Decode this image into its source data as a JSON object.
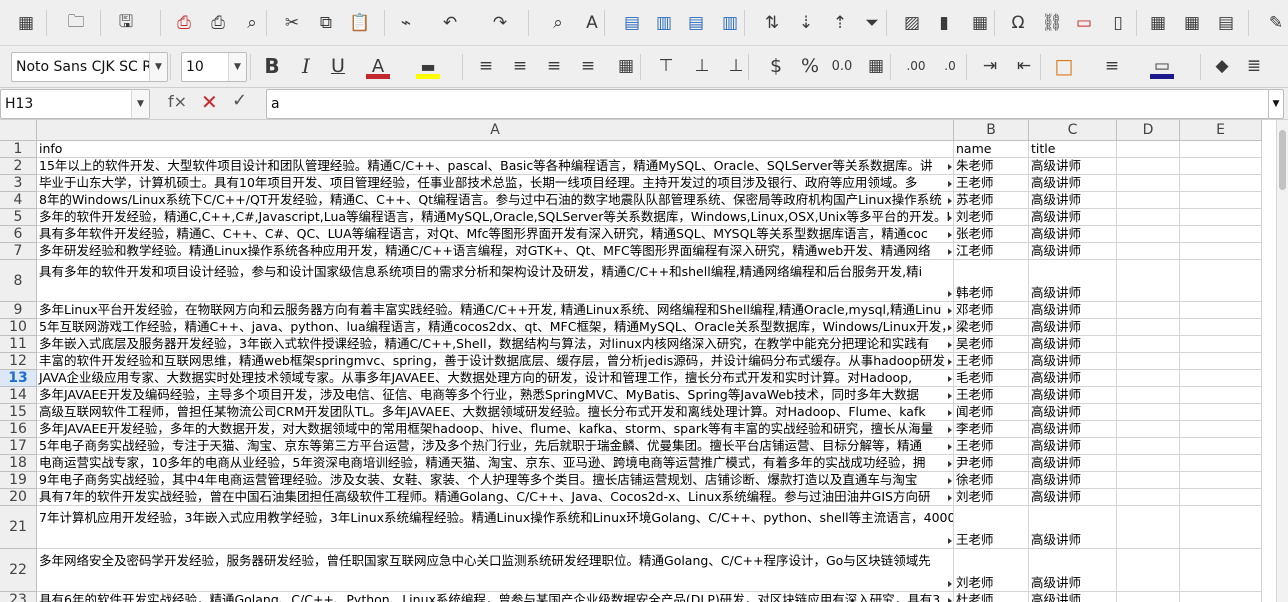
{
  "toolbar": {
    "font_name": "Noto Sans CJK SC R",
    "font_size": "10",
    "font_color": "#c0282e",
    "highlight_color": "#ffff00",
    "border_color": "#1a1a8c",
    "icons": [
      "spreadsheet-icon",
      "open-icon",
      "save-icon",
      "export-pdf-icon",
      "print-icon",
      "print-preview-icon",
      "cut-icon",
      "copy-icon",
      "paste-icon",
      "clone-formatting-icon",
      "undo-icon",
      "redo-icon",
      "find-replace-icon",
      "spelling-icon",
      "row-icon",
      "column-icon",
      "delete-row-icon",
      "delete-column-icon",
      "sort-icon",
      "sort-ascending-icon",
      "sort-descending-icon",
      "autofilter-icon",
      "insert-image-icon",
      "insert-chart-icon",
      "pivot-table-icon",
      "special-character-icon",
      "hyperlink-icon",
      "comment-icon",
      "header-footer-icon",
      "define-print-area-icon",
      "freeze-icon",
      "split-window-icon",
      "show-draw-functions-icon"
    ]
  },
  "formula_bar": {
    "name_box": "H13",
    "function_wizard": "f×",
    "formula": "a"
  },
  "columns": [
    "A",
    "B",
    "C",
    "D",
    "E"
  ],
  "selected_row": "13",
  "rows": [
    {
      "num": "1",
      "a": "info",
      "b": "name",
      "c": "title"
    },
    {
      "num": "2",
      "a": "15年以上的软件开发、大型软件项目设计和团队管理经验。精通C/C++、pascal、Basic等各种编程语言，精通MySQL、Oracle、SQLServer等关系数据库。讲",
      "b": "朱老师",
      "c": "高级讲师"
    },
    {
      "num": "3",
      "a": "毕业于山东大学，计算机硕士。具有10年项目开发、项目管理经验，任事业部技术总监，长期一线项目经理。主持开发过的项目涉及银行、政府等应用领域。多",
      "b": "王老师",
      "c": "高级讲师"
    },
    {
      "num": "4",
      "a": "8年的Windows/Linux系统下C/C++/QT开发经验，精通C、C++、Qt编程语言。参与过中石油的数字地震队队部管理系统、保密局等政府机构国产Linux操作系统",
      "b": "苏老师",
      "c": "高级讲师"
    },
    {
      "num": "5",
      "a": "多年的软件开发经验，精通C,C++,C#,Javascript,Lua等编程语言，精通MySQL,Oracle,SQLServer等关系数据库，Windows,Linux,OSX,Unix等多平台的开发。Ⅰ",
      "b": "刘老师",
      "c": "高级讲师"
    },
    {
      "num": "6",
      "a": "具有多年软件开发经验，精通C、C++、C#、QC、LUA等编程语言，对Qt、Mfc等图形界面开发有深入研究，精通SQL、MYSQL等关系型数据库语言，精通coc",
      "b": "张老师",
      "c": "高级讲师"
    },
    {
      "num": "7",
      "a": "多年研发经验和教学经验。精通Linux操作系统各种应用开发，精通C/C++语言编程，对GTK+、Qt、MFC等图形界面编程有深入研究，精通web开发、精通网络",
      "b": "江老师",
      "c": "高级讲师"
    },
    {
      "num": "8",
      "a": "具有多年的软件开发和项目设计经验，参与和设计国家级信息系统项目的需求分析和架构设计及研发，精通C/C++和shell编程,精通网络编程和后台服务开发,精i",
      "b": "韩老师",
      "c": "高级讲师"
    },
    {
      "num": "9",
      "a": "多年Linux平台开发经验，在物联网方向和云服务器方向有着丰富实践经验。精通C/C++开发, 精通Linux系统、网络编程和Shell编程,精通Oracle,mysql,精通Linu",
      "b": "邓老师",
      "c": "高级讲师"
    },
    {
      "num": "10",
      "a": "5年互联网游戏工作经验，精通C++、java、python、lua编程语言，精通cocos2dx、qt、MFC框架，精通MySQL、Oracle关系型数据库，Windows/Linux开发，",
      "b": "梁老师",
      "c": "高级讲师"
    },
    {
      "num": "11",
      "a": "多年嵌入式底层及服务器开发经验，3年嵌入式软件授课经验，精通C/C++,Shell，数据结构与算法，对linux内核网络深入研究，在教学中能充分把理论和实践有",
      "b": "吴老师",
      "c": "高级讲师"
    },
    {
      "num": "12",
      "a": "丰富的软件开发经验和互联网思维，精通web框架springmvc、spring，善于设计数据底层、缓存层，曾分析jedis源码，并设计编码分布式缓存。从事hadoop研发",
      "b": "王老师",
      "c": "高级讲师"
    },
    {
      "num": "13",
      "a": "JAVA企业级应用专家、大数据实时处理技术领域专家。从事多年JAVAEE、大数据处理方向的研发，设计和管理工作，擅长分布式开发和实时计算。对Hadoop,",
      "b": "毛老师",
      "c": "高级讲师"
    },
    {
      "num": "14",
      "a": "多年JAVAEE开发及编码经验，主导多个项目开发，涉及电信、征信、电商等多个行业，熟悉SpringMVC、MyBatis、Spring等JavaWeb技术，同时多年大数据",
      "b": "王老师",
      "c": "高级讲师"
    },
    {
      "num": "15",
      "a": "高级互联网软件工程师，曾担任某物流公司CRM开发团队TL。多年JAVAEE、大数据领域研发经验。擅长分布式开发和离线处理计算。对Hadoop、Flume、kafk",
      "b": "闻老师",
      "c": "高级讲师"
    },
    {
      "num": "16",
      "a": "多年JAVAEE开发经验，多年的大数据开发，对大数据领域中的常用框架hadoop、hive、flume、kafka、storm、spark等有丰富的实战经验和研究，擅长从海量",
      "b": "李老师",
      "c": "高级讲师"
    },
    {
      "num": "17",
      "a": "5年电子商务实战经验，专注于天猫、淘宝、京东等第三方平台运营，涉及多个热门行业，先后就职于瑞金麟、优曼集团。擅长平台店铺运营、目标分解等，精通",
      "b": "王老师",
      "c": "高级讲师"
    },
    {
      "num": "18",
      "a": "电商运营实战专家，10多年的电商从业经验，5年资深电商培训经验，精通天猫、淘宝、京东、亚马逊、跨境电商等运营推广模式，有着多年的实战成功经验，拥",
      "b": "尹老师",
      "c": "高级讲师"
    },
    {
      "num": "19",
      "a": "9年电子商务实战经验，其中4年电商运营管理经验。涉及女装、女鞋、家装、个人护理等多个类目。擅长店铺运营规划、店铺诊断、爆款打造以及直通车与淘宝",
      "b": "徐老师",
      "c": "高级讲师"
    },
    {
      "num": "20",
      "a": "具有7年的软件开发实战经验，曾在中国石油集团担任高级软件工程师。精通Golang、C/C++、Java、Cocos2d-x、Linux系统编程。参与过油田油井GIS方向研",
      "b": "刘老师",
      "c": "高级讲师"
    },
    {
      "num": "21",
      "a": "7年计算机应用开发经验，3年嵌入式应用教学经验，3年Linux系统编程经验。精通Linux操作系统和Linux环境Golang、C/C++、python、shell等主流语言，4000",
      "b": "王老师",
      "c": "高级讲师"
    },
    {
      "num": "22",
      "a": "多年网络安全及密码学开发经验，服务器研发经验，曾任职国家互联网应急中心关口监测系统研发经理职位。精通Golang、C/C++程序设计，Go与区块链领域先",
      "b": "刘老师",
      "c": "高级讲师"
    },
    {
      "num": "23",
      "a": "具有6年的软件开发实战经验，精通Golang、C/C++、Python、Linux系统编程，曾参与某国产企业级数据安全产品(DLP)研发，对区块链应用有深入研究，具有3",
      "b": "杜老师",
      "c": "高级讲师"
    }
  ]
}
